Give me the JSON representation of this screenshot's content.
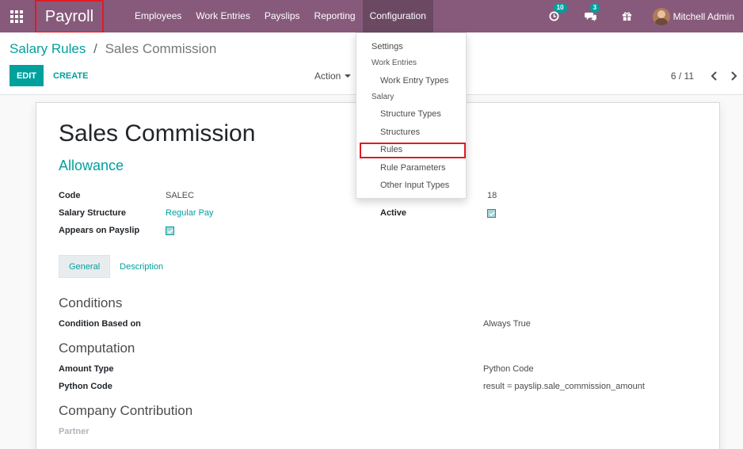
{
  "navbar": {
    "app_name": "Payroll",
    "menu": [
      "Employees",
      "Work Entries",
      "Payslips",
      "Reporting",
      "Configuration"
    ],
    "activity_count": "10",
    "message_count": "3",
    "user_name": "Mitchell Admin"
  },
  "breadcrumb": {
    "parent": "Salary Rules",
    "separator": "/",
    "current": "Sales Commission"
  },
  "toolbar": {
    "edit_label": "EDIT",
    "create_label": "CREATE",
    "action_label": "Action"
  },
  "pager": {
    "value": "6 / 11"
  },
  "form": {
    "title": "Sales Commission",
    "category": "Allowance",
    "code_label": "Code",
    "code_value": "SALEC",
    "structure_label": "Salary Structure",
    "structure_value": "Regular Pay",
    "payslip_label": "Appears on Payslip",
    "sequence_value": "18",
    "active_label": "Active",
    "tabs": [
      "General",
      "Description"
    ],
    "conditions_title": "Conditions",
    "condition_label": "Condition Based on",
    "condition_value": "Always True",
    "computation_title": "Computation",
    "amount_type_label": "Amount Type",
    "amount_type_value": "Python Code",
    "python_code_label": "Python Code",
    "python_code_value": "result = payslip.sale_commission_amount",
    "contribution_title": "Company Contribution",
    "partner_label": "Partner"
  },
  "dropdown": {
    "settings": "Settings",
    "work_entries_header": "Work Entries",
    "work_entry_types": "Work Entry Types",
    "salary_header": "Salary",
    "structure_types": "Structure Types",
    "structures": "Structures",
    "rules": "Rules",
    "rule_parameters": "Rule Parameters",
    "other_input_types": "Other Input Types"
  },
  "colors": {
    "navbar": "#875a7b",
    "accent": "#00a09d",
    "highlight": "#e01b24"
  }
}
